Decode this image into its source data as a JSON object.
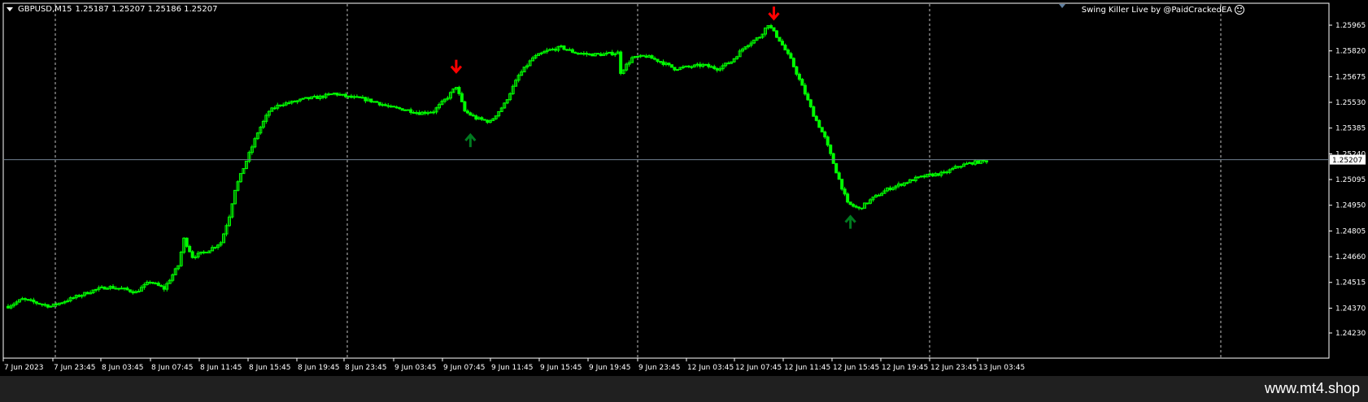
{
  "header": {
    "symbol_label": "GBPUSD,M15",
    "ohlc": "1.25187 1.25207 1.25186 1.25207"
  },
  "indicator_label": "Swing Killer Live by @PaidCrackedEA",
  "footer": {
    "site": "www.mt4.shop"
  },
  "colors": {
    "background": "#000000",
    "candle": "#00ff00",
    "grid": "#c0c0c0",
    "sell_arrow": "#ff0000",
    "buy_arrow": "#007a1f",
    "price_line": "#708090"
  },
  "chart_data": {
    "type": "candlestick",
    "symbol": "GBPUSD",
    "timeframe": "M15",
    "current_price": "1.25207",
    "y_ticks": [
      "1.25965",
      "1.25820",
      "1.25675",
      "1.25530",
      "1.25385",
      "1.25240",
      "1.25095",
      "1.24950",
      "1.24805",
      "1.24660",
      "1.24515",
      "1.24370",
      "1.24230"
    ],
    "ylim": [
      1.2423,
      1.2604
    ],
    "x_ticks": [
      "7 Jun 2023",
      "7 Jun 23:45",
      "8 Jun 03:45",
      "8 Jun 07:45",
      "8 Jun 11:45",
      "8 Jun 15:45",
      "8 Jun 19:45",
      "8 Jun 23:45",
      "9 Jun 03:45",
      "9 Jun 07:45",
      "9 Jun 11:45",
      "9 Jun 15:45",
      "9 Jun 19:45",
      "9 Jun 23:45",
      "12 Jun 03:45",
      "12 Jun 07:45",
      "12 Jun 11:45",
      "12 Jun 15:45",
      "12 Jun 19:45",
      "12 Jun 23:45",
      "13 Jun 03:45"
    ],
    "close_path": [
      [
        0,
        1.2438
      ],
      [
        5,
        1.2442
      ],
      [
        10,
        1.244
      ],
      [
        15,
        1.2438
      ],
      [
        20,
        1.2441
      ],
      [
        25,
        1.2444
      ],
      [
        30,
        1.2447
      ],
      [
        35,
        1.2449
      ],
      [
        40,
        1.2448
      ],
      [
        45,
        1.2446
      ],
      [
        50,
        1.2452
      ],
      [
        55,
        1.2448
      ],
      [
        60,
        1.2461
      ],
      [
        62,
        1.2476
      ],
      [
        65,
        1.2466
      ],
      [
        70,
        1.2469
      ],
      [
        75,
        1.2474
      ],
      [
        78,
        1.2489
      ],
      [
        80,
        1.2504
      ],
      [
        84,
        1.252
      ],
      [
        88,
        1.2536
      ],
      [
        92,
        1.2548
      ],
      [
        96,
        1.2552
      ],
      [
        100,
        1.2553
      ],
      [
        105,
        1.2555
      ],
      [
        110,
        1.2556
      ],
      [
        115,
        1.2558
      ],
      [
        120,
        1.2556
      ],
      [
        125,
        1.2555
      ],
      [
        130,
        1.2553
      ],
      [
        135,
        1.255
      ],
      [
        140,
        1.2549
      ],
      [
        145,
        1.2547
      ],
      [
        150,
        1.2548
      ],
      [
        155,
        1.2556
      ],
      [
        158,
        1.2562
      ],
      [
        161,
        1.2548
      ],
      [
        165,
        1.2544
      ],
      [
        170,
        1.2542
      ],
      [
        175,
        1.2552
      ],
      [
        180,
        1.2568
      ],
      [
        185,
        1.2578
      ],
      [
        190,
        1.2582
      ],
      [
        195,
        1.2584
      ],
      [
        200,
        1.2581
      ],
      [
        205,
        1.258
      ],
      [
        210,
        1.258
      ],
      [
        215,
        1.2581
      ],
      [
        216,
        1.257
      ],
      [
        220,
        1.2578
      ],
      [
        225,
        1.2579
      ],
      [
        230,
        1.2576
      ],
      [
        235,
        1.2572
      ],
      [
        240,
        1.2573
      ],
      [
        245,
        1.2574
      ],
      [
        250,
        1.2572
      ],
      [
        255,
        1.2576
      ],
      [
        260,
        1.2585
      ],
      [
        265,
        1.259
      ],
      [
        268,
        1.2597
      ],
      [
        272,
        1.2588
      ],
      [
        276,
        1.2577
      ],
      [
        280,
        1.2562
      ],
      [
        284,
        1.2546
      ],
      [
        288,
        1.2533
      ],
      [
        292,
        1.2514
      ],
      [
        296,
        1.2496
      ],
      [
        300,
        1.2493
      ],
      [
        305,
        1.2499
      ],
      [
        310,
        1.2504
      ],
      [
        315,
        1.2507
      ],
      [
        320,
        1.251
      ],
      [
        325,
        1.2512
      ],
      [
        330,
        1.2513
      ],
      [
        335,
        1.2517
      ],
      [
        340,
        1.2519
      ],
      [
        345,
        1.252
      ]
    ],
    "signals": [
      {
        "type": "sell",
        "bar": 158,
        "price": 1.2566
      },
      {
        "type": "buy",
        "bar": 163,
        "price": 1.2536
      },
      {
        "type": "sell",
        "bar": 270,
        "price": 1.2596
      },
      {
        "type": "buy",
        "bar": 297,
        "price": 1.249
      }
    ],
    "grid": "dashed-vertical",
    "scale_position": "right"
  }
}
